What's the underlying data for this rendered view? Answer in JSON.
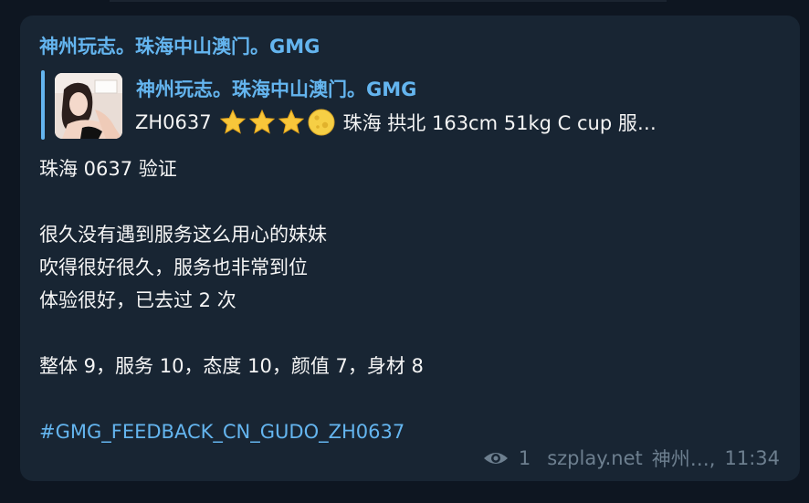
{
  "message": {
    "channel_name": "神州玩志。珠海中山澳门。GMG",
    "reply": {
      "title": "神州玩志。珠海中山澳门。GMG",
      "code": "ZH0637",
      "rating_icons": [
        "star-icon",
        "star-icon",
        "star-icon",
        "moon-icon"
      ],
      "details": "珠海 拱北 163cm  51kg  C cup  服…"
    },
    "lines": [
      "珠海 0637 验证",
      "",
      "很久没有遇到服务这么用心的妹妹",
      "吹得很好很久，服务也非常到位",
      "体验很好，已去过 2 次",
      "",
      "整体 9，服务 10，态度 10，颜值 7，身材 8",
      ""
    ],
    "hashtag": "#GMG_FEEDBACK_CN_GUDO_ZH0637",
    "footer": {
      "views": "1",
      "site": "szplay.net",
      "author": "神州…,",
      "time": "11:34"
    }
  },
  "colors": {
    "background": "#0e1621",
    "bubble": "#182533",
    "accent": "#64b5ef",
    "text": "#f5f5f5",
    "meta": "#6d7f8f"
  }
}
